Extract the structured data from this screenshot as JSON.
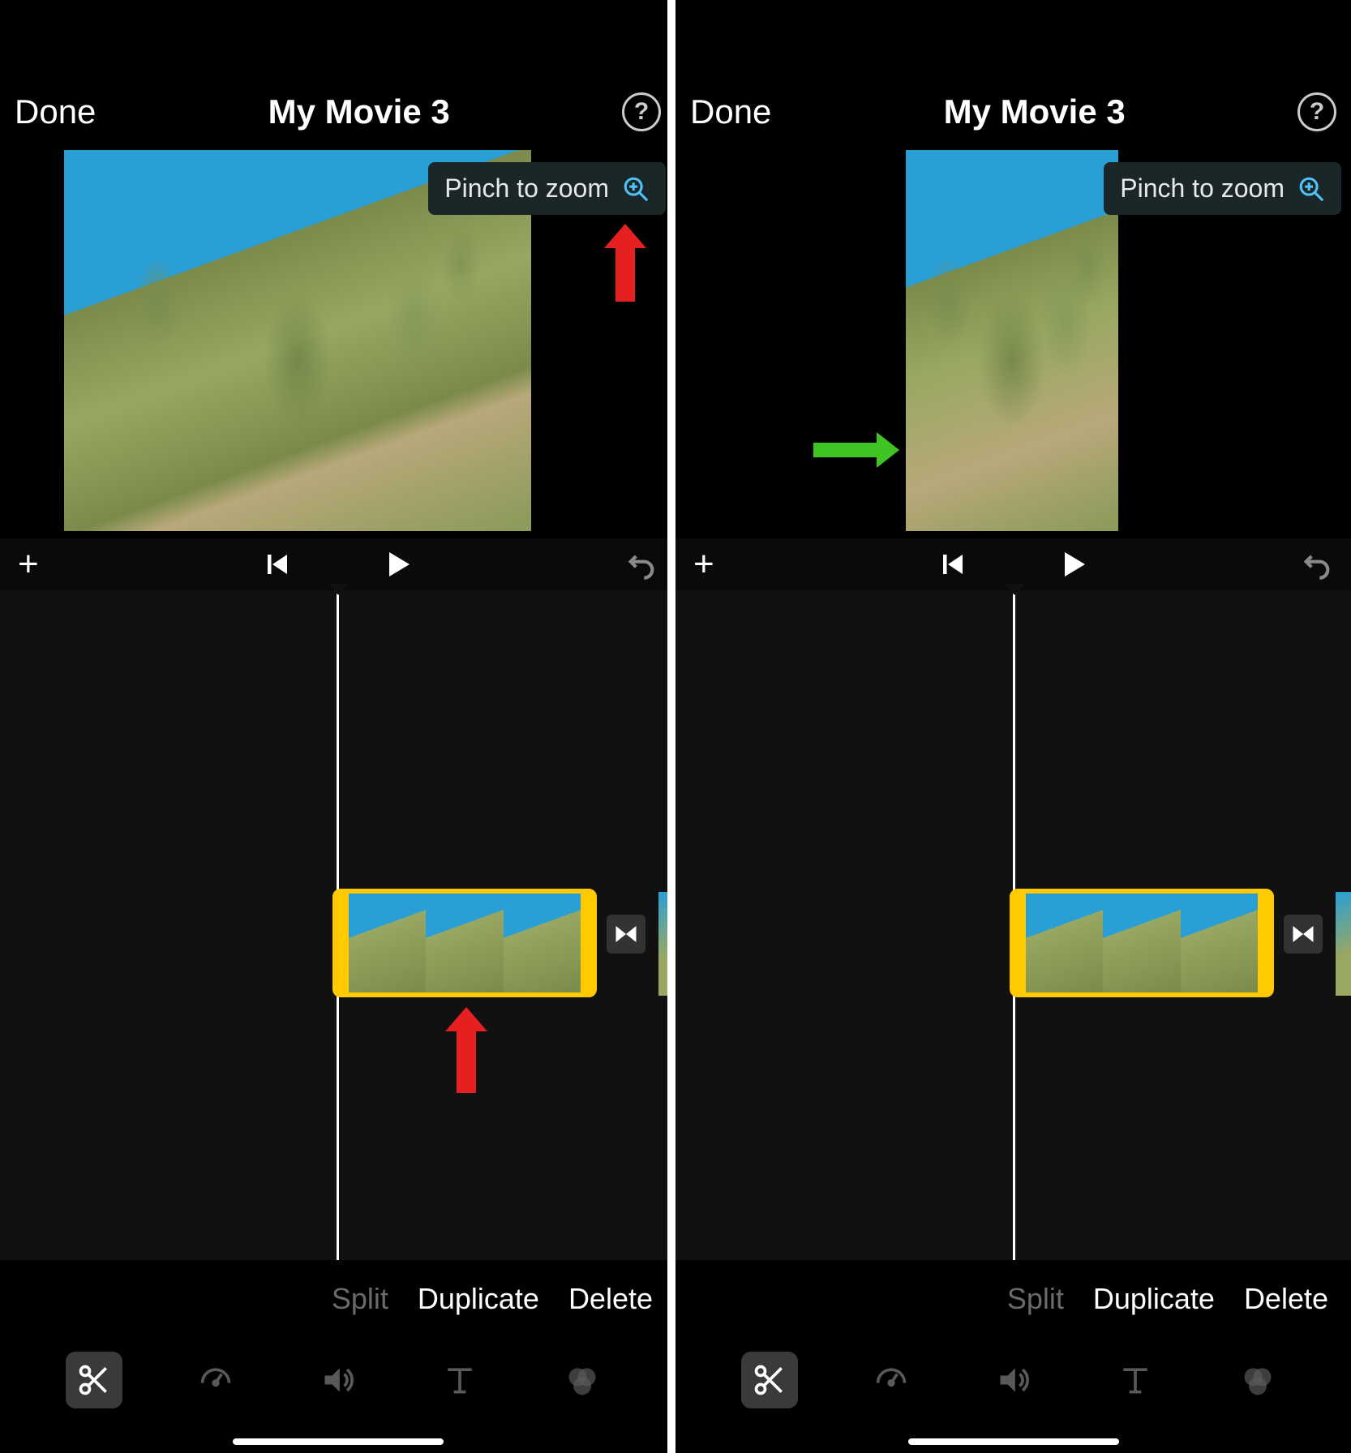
{
  "left": {
    "header": {
      "done": "Done",
      "title": "My Movie 3",
      "help_icon": "help-icon"
    },
    "pinch_label": "Pinch to zoom",
    "clip_options": {
      "split": "Split",
      "duplicate": "Duplicate",
      "delete": "Delete"
    },
    "toolbar_icons": {
      "scissors": "scissors-icon",
      "speed": "speedometer-icon",
      "audio": "speaker-icon",
      "text": "text-icon",
      "filter": "filter-icon"
    },
    "annotations": {
      "arrow1": "red-up-arrow",
      "arrow2": "red-up-arrow"
    }
  },
  "right": {
    "header": {
      "done": "Done",
      "title": "My Movie 3",
      "help_icon": "help-icon"
    },
    "pinch_label": "Pinch to zoom",
    "clip_options": {
      "split": "Split",
      "duplicate": "Duplicate",
      "delete": "Delete"
    },
    "toolbar_icons": {
      "scissors": "scissors-icon",
      "speed": "speedometer-icon",
      "audio": "speaker-icon",
      "text": "text-icon",
      "filter": "filter-icon"
    },
    "annotations": {
      "arrow1": "green-right-arrow"
    }
  }
}
